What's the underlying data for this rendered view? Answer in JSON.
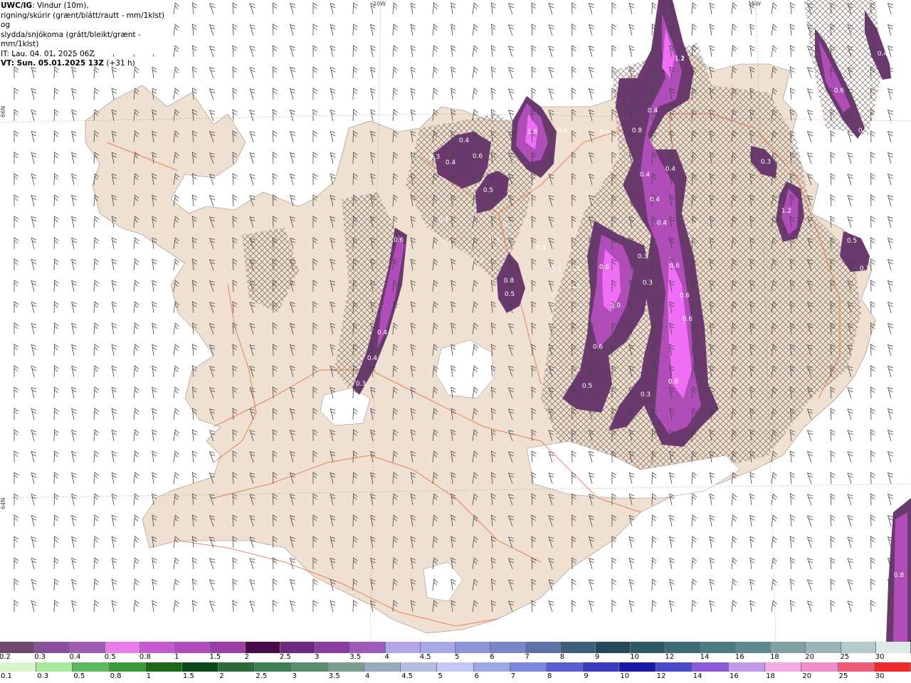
{
  "header": {
    "product": "UWC/IG",
    "line1_rest": ": Vindur (10m),",
    "line2": "rigning/skúrir (grænt/blátt/rautt - mm/1klst) og",
    "line3": "slydda/snjókoma (grátt/bleikt/grænt - mm/1klst)",
    "line4": "IT: Lau. 04. 01. 2025 06Z",
    "line5_bold": "VT: Sun. 05.01.2025 13Z",
    "line5_rest": " (+31 h)"
  },
  "grid_labels": {
    "lon_20w": "20W",
    "lon_15w": "15W",
    "lat_66n": "66N",
    "lat_64n": "64N"
  },
  "map_labels": [
    "0.3",
    "0.4",
    "0.6",
    "0.5",
    "0.3",
    "0.4",
    "1.6",
    "0.4",
    "0.3",
    "0.8",
    "0.4",
    "1.1",
    "0.4",
    "0.3",
    "0.4",
    "0.4",
    "0.4",
    "0.3",
    "0.3",
    "0.3",
    "0.5",
    "0.6",
    "0.6",
    "0.3",
    "0.3",
    "0.8",
    "0.5",
    "0.3",
    "0.3",
    "0.3",
    "0.6",
    "0.6",
    "1.0",
    "0.6",
    "0.4",
    "0.4",
    "0.3",
    "0.5",
    "0.8",
    "0.6",
    "0.3",
    "0.3",
    "1.2",
    "0.5",
    "0.3",
    "0.4",
    "0.6",
    "0.3",
    "0.8",
    "1.2"
  ],
  "colors": {
    "land": "#f0e0d2",
    "ocean": "#ffffff",
    "roads": "#e06b3c",
    "snow_light": "#f06ef5",
    "snow_mid": "#b04db8",
    "snow_dark": "#6a3a6e"
  },
  "legend_snow": {
    "labels": [
      "0.2",
      "0.3",
      "0.4",
      "0.5",
      "0.8",
      "1",
      "1.5",
      "2",
      "2.5",
      "3",
      "3.5",
      "4",
      "4.5",
      "5",
      "6",
      "7",
      "8",
      "9",
      "10",
      "12",
      "14",
      "16",
      "18",
      "20",
      "25",
      "30"
    ],
    "colors": [
      "#6e4a6e",
      "#8a4f9a",
      "#9f5bb0",
      "#e87de8",
      "#c65ad0",
      "#b14cbc",
      "#9b3fa7",
      "#4a0a4a",
      "#6b2a80",
      "#8a3fa0",
      "#9a5cb8",
      "#b4a4ea",
      "#a6a8e8",
      "#8e96d8",
      "#7a86c8",
      "#5e72a6",
      "#3c5e7a",
      "#244a5a",
      "#2e5a66",
      "#3e6a74",
      "#4e7a82",
      "#5e8a8e",
      "#80a0a4",
      "#9ab4b8",
      "#b6caca",
      "#dfe9e8"
    ]
  },
  "legend_rain": {
    "labels": [
      "0.1",
      "0.3",
      "0.5",
      "0.8",
      "1",
      "1.5",
      "2",
      "2.5",
      "3",
      "3.5",
      "4",
      "4.5",
      "5",
      "6",
      "7",
      "8",
      "9",
      "10",
      "12",
      "14",
      "16",
      "18",
      "20",
      "25",
      "30"
    ],
    "colors": [
      "#d8f5d0",
      "#a8e89a",
      "#5cb85c",
      "#3a9a3a",
      "#1a6a1a",
      "#0a4a1a",
      "#2a6a3a",
      "#3e7e56",
      "#5a8e6e",
      "#7a9e8e",
      "#9aaabe",
      "#b4bcde",
      "#c4c8f4",
      "#a0a8e8",
      "#7c88dc",
      "#5a5ed2",
      "#3a3abe",
      "#1a1aa8",
      "#4848c8",
      "#8a5ad8",
      "#c09ae8",
      "#f4aae4",
      "#f08cc8",
      "#f05a7a",
      "#f02a2a"
    ]
  }
}
